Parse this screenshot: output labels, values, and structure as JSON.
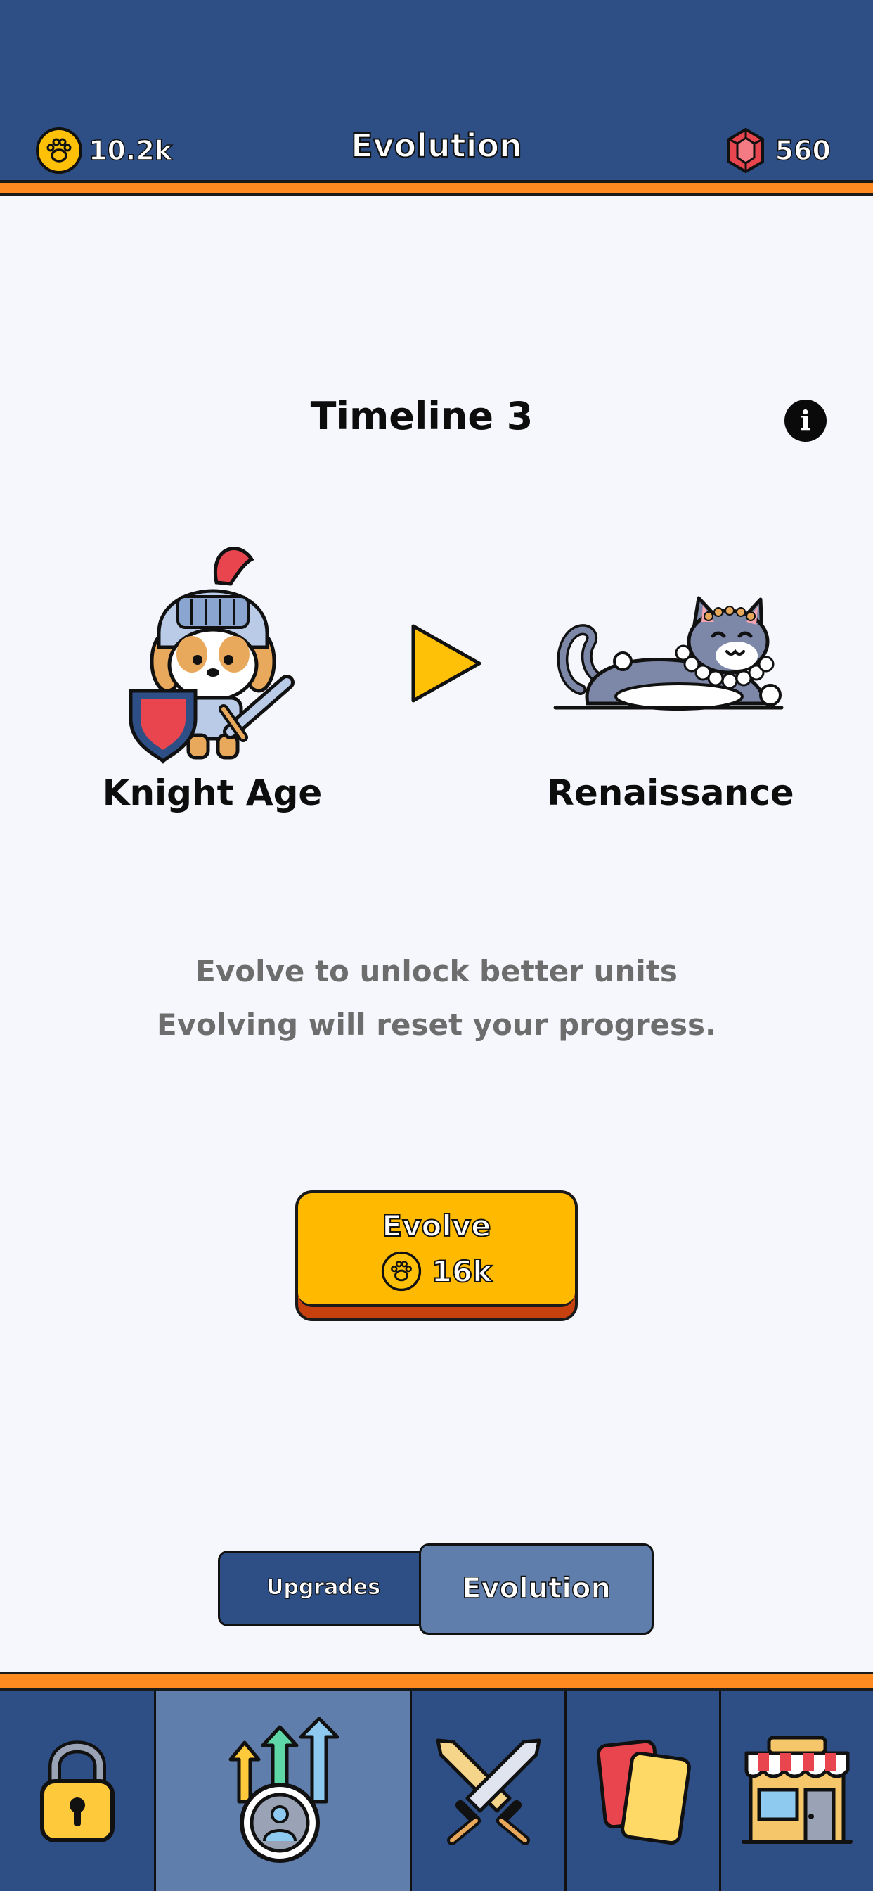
{
  "header": {
    "title": "Evolution",
    "paw_currency": "10.2k",
    "gem_currency": "560",
    "colors": {
      "bar": "#2e4f85",
      "stripe": "#ff8a1f"
    }
  },
  "main": {
    "timeline_title": "Timeline 3",
    "info_icon": "info-icon",
    "current_era": "Knight Age",
    "next_era": "Renaissance",
    "description_line1": "Evolve to unlock better units",
    "description_line2": "Evolving will reset your progress.",
    "evolve_button": {
      "label": "Evolve",
      "cost": "16k",
      "color": "#ffba00"
    }
  },
  "tabs": {
    "upgrades": "Upgrades",
    "evolution": "Evolution",
    "active": "evolution"
  },
  "nav": {
    "items": [
      {
        "icon": "padlock-icon"
      },
      {
        "icon": "upgrade-arrows-icon",
        "active": true
      },
      {
        "icon": "crossed-swords-icon"
      },
      {
        "icon": "cards-icon"
      },
      {
        "icon": "shop-icon"
      }
    ]
  }
}
